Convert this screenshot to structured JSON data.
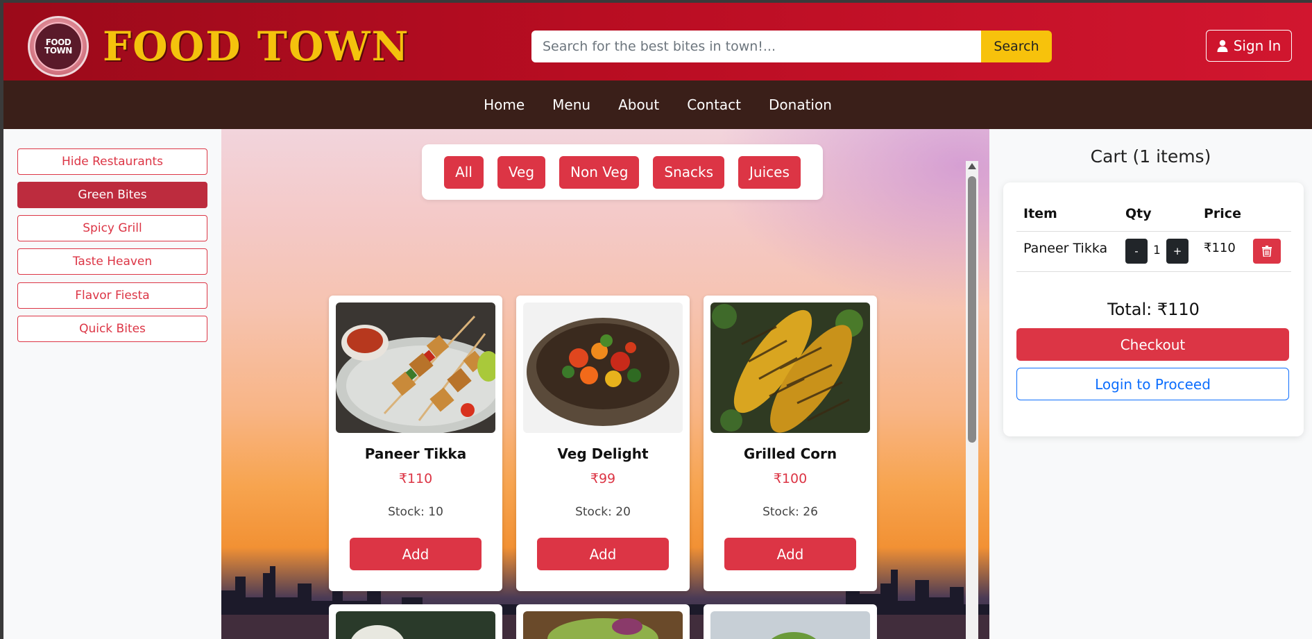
{
  "header": {
    "logo_text_line1": "FOOD",
    "logo_text_line2": "TOWN",
    "brand": "FOOD TOWN",
    "search_placeholder": "Search for the best bites in town!...",
    "search_label": "Search",
    "signin_label": "Sign In"
  },
  "nav": {
    "items": [
      "Home",
      "Menu",
      "About",
      "Contact",
      "Donation"
    ]
  },
  "sidebar": {
    "items": [
      {
        "label": "Hide Restaurants",
        "active": false
      },
      {
        "label": "Green Bites",
        "active": true
      },
      {
        "label": "Spicy Grill",
        "active": false
      },
      {
        "label": "Taste Heaven",
        "active": false
      },
      {
        "label": "Flavor Fiesta",
        "active": false
      },
      {
        "label": "Quick Bites",
        "active": false
      }
    ]
  },
  "filters": [
    "All",
    "Veg",
    "Non Veg",
    "Snacks",
    "Juices"
  ],
  "products": [
    {
      "name": "Paneer Tikka",
      "price": "₹110",
      "stock": "Stock: 10",
      "add_label": "Add",
      "image": "paneer-tikka-skewers"
    },
    {
      "name": "Veg Delight",
      "price": "₹99",
      "stock": "Stock: 20",
      "add_label": "Add",
      "image": "veg-stir-fry-bowl"
    },
    {
      "name": "Grilled Corn",
      "price": "₹100",
      "stock": "Stock: 26",
      "add_label": "Add",
      "image": "grilled-corn-cobs"
    }
  ],
  "cart": {
    "title": "Cart (1 items)",
    "columns": {
      "item": "Item",
      "qty": "Qty",
      "price": "Price"
    },
    "rows": [
      {
        "item": "Paneer Tikka",
        "qty": "1",
        "price": "₹110",
        "minus": "-",
        "plus": "+"
      }
    ],
    "total": "Total: ₹110",
    "checkout_label": "Checkout",
    "login_label": "Login to Proceed"
  },
  "colors": {
    "brand_gold": "#f4c20d",
    "header_red": "#b80d22",
    "nav_brown": "#3a1f19",
    "primary_red": "#dc3545",
    "link_blue": "#0d6efd"
  }
}
